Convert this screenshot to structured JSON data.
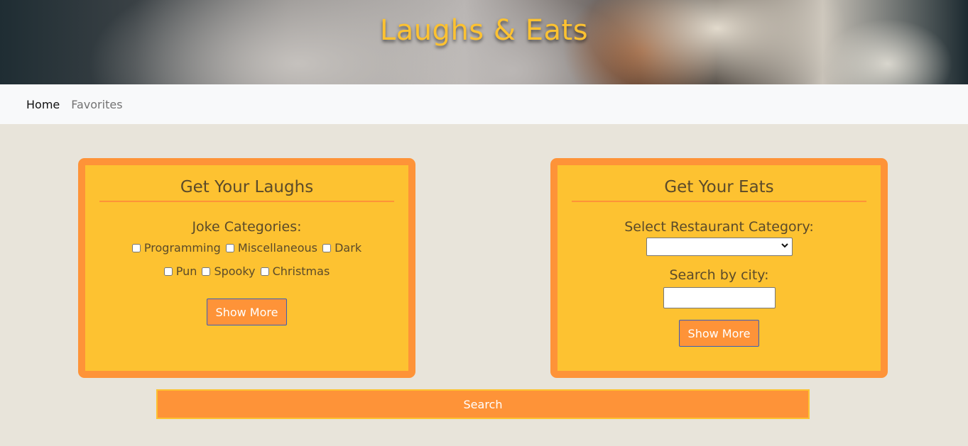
{
  "header": {
    "title": "Laughs & Eats"
  },
  "nav": {
    "home": "Home",
    "favorites": "Favorites"
  },
  "laughs": {
    "title": "Get Your Laughs",
    "categories_label": "Joke Categories:",
    "categories_row1": [
      "Programming",
      "Miscellaneous",
      "Dark"
    ],
    "categories_row2": [
      "Pun",
      "Spooky",
      "Christmas"
    ],
    "show_more": "Show More"
  },
  "eats": {
    "title": "Get Your Eats",
    "category_label": "Select Restaurant Category:",
    "category_selected": "",
    "city_label": "Search by city:",
    "city_value": "",
    "show_more": "Show More"
  },
  "search_button": "Search",
  "colors": {
    "accent_orange": "#fe9338",
    "accent_yellow": "#fdc231",
    "page_bg": "#e8e4da"
  }
}
